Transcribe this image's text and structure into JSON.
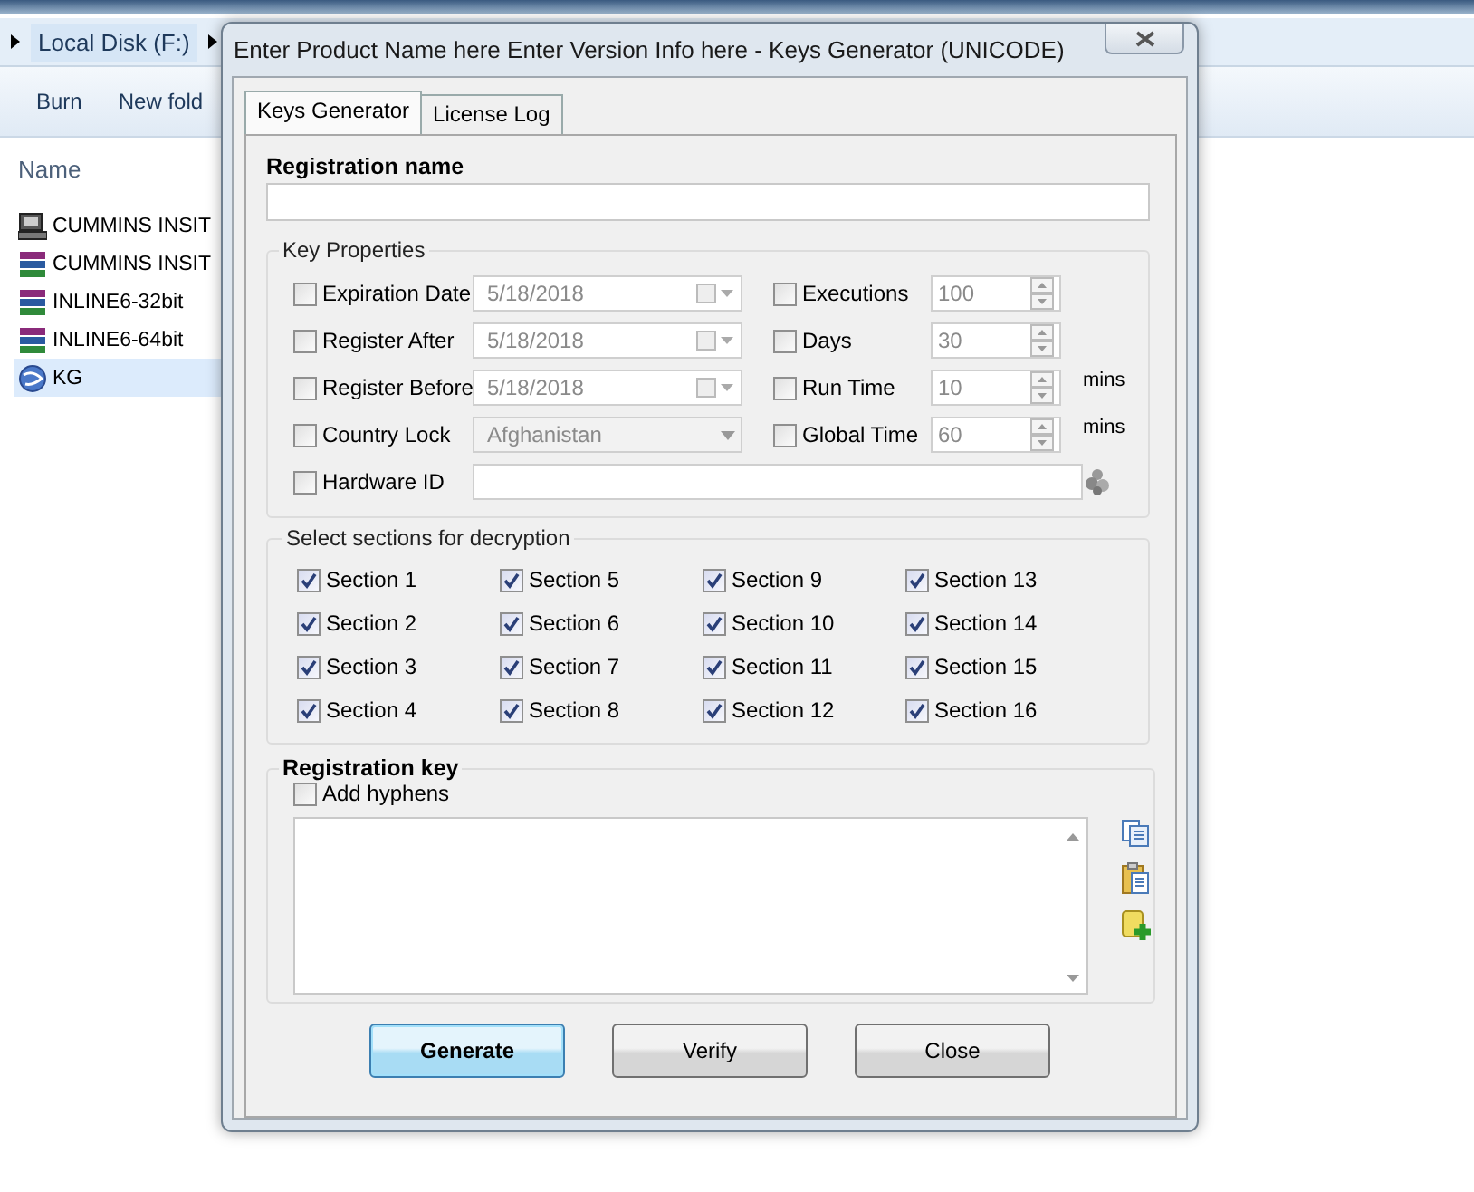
{
  "explorer": {
    "breadcrumb": [
      "Local Disk (F:)"
    ],
    "toolbar": [
      "Burn",
      "New fold"
    ],
    "column_header": "Name",
    "files": [
      {
        "name": "CUMMINS INSIT",
        "kind": "setup",
        "selected": false
      },
      {
        "name": "CUMMINS INSIT",
        "kind": "archive",
        "selected": false
      },
      {
        "name": "INLINE6-32bit",
        "kind": "archive",
        "selected": false
      },
      {
        "name": "INLINE6-64bit",
        "kind": "archive",
        "selected": false
      },
      {
        "name": "KG",
        "kind": "app",
        "selected": true
      }
    ]
  },
  "dialog": {
    "title": "Enter Product Name here Enter Version Info here - Keys Generator (UNICODE)",
    "tabs": [
      {
        "label": "Keys Generator",
        "selected": true
      },
      {
        "label": "License Log",
        "selected": false
      }
    ],
    "registration_name": {
      "label": "Registration name"
    },
    "key_properties": {
      "title": "Key Properties",
      "rows": [
        {
          "left": {
            "label": "Expiration Date",
            "checked": false,
            "kind": "date",
            "value": "5/18/2018"
          },
          "right": {
            "label": "Executions",
            "checked": false,
            "value": "100"
          }
        },
        {
          "left": {
            "label": "Register After",
            "checked": false,
            "kind": "date",
            "value": "5/18/2018"
          },
          "right": {
            "label": "Days",
            "checked": false,
            "value": "30"
          }
        },
        {
          "left": {
            "label": "Register Before",
            "checked": false,
            "kind": "date",
            "value": "5/18/2018"
          },
          "right": {
            "label": "Run Time",
            "checked": false,
            "value": "10",
            "unit": "mins"
          }
        },
        {
          "left": {
            "label": "Country Lock",
            "checked": false,
            "kind": "dropdown",
            "value": "Afghanistan"
          },
          "right": {
            "label": "Global Time",
            "checked": false,
            "value": "60",
            "unit": "mins"
          }
        },
        {
          "left": {
            "label": "Hardware ID",
            "checked": false,
            "kind": "text"
          }
        }
      ]
    },
    "sections": {
      "title": "Select sections for decryption",
      "items": [
        {
          "label": "Section 1",
          "checked": true
        },
        {
          "label": "Section 2",
          "checked": true
        },
        {
          "label": "Section 3",
          "checked": true
        },
        {
          "label": "Section 4",
          "checked": true
        },
        {
          "label": "Section 5",
          "checked": true
        },
        {
          "label": "Section 6",
          "checked": true
        },
        {
          "label": "Section 7",
          "checked": true
        },
        {
          "label": "Section 8",
          "checked": true
        },
        {
          "label": "Section 9",
          "checked": true
        },
        {
          "label": "Section 10",
          "checked": true
        },
        {
          "label": "Section 11",
          "checked": true
        },
        {
          "label": "Section 12",
          "checked": true
        },
        {
          "label": "Section 13",
          "checked": true
        },
        {
          "label": "Section 14",
          "checked": true
        },
        {
          "label": "Section 15",
          "checked": true
        },
        {
          "label": "Section 16",
          "checked": true
        }
      ]
    },
    "registration_key": {
      "title": "Registration key",
      "add_hyphens": {
        "label": "Add hyphens",
        "checked": false
      }
    },
    "buttons": [
      {
        "label": "Generate",
        "focused": true
      },
      {
        "label": "Verify",
        "focused": false
      },
      {
        "label": "Close",
        "focused": false
      }
    ]
  }
}
